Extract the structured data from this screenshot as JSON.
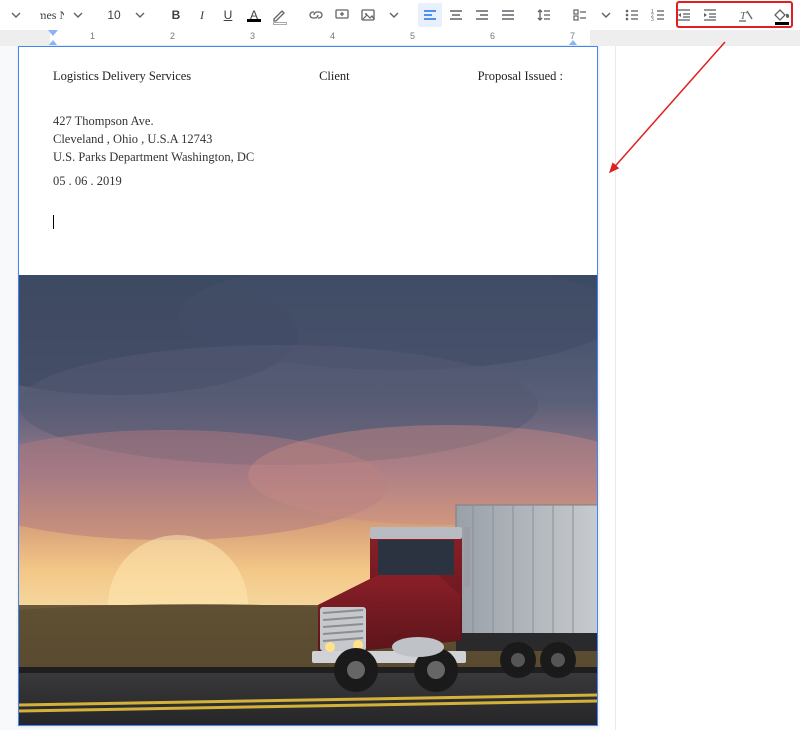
{
  "toolbar": {
    "font_name": "Times N...",
    "font_size": "10"
  },
  "ruler": {
    "numbers": [
      "1",
      "2",
      "3",
      "4",
      "5",
      "6",
      "7"
    ]
  },
  "doc": {
    "header": {
      "col1": "Logistics Delivery Services",
      "col2": "Client",
      "col3": "Proposal Issued :"
    },
    "address": {
      "line1": "427 Thompson Ave.",
      "line2": "Cleveland , Ohio , U.S.A 12743",
      "line3": "U.S. Parks Department Washington, DC",
      "date": "05 . 06 . 2019"
    }
  },
  "icons": {
    "caret": "chevron-down-icon",
    "bold": "B",
    "italic": "I",
    "underline": "U"
  }
}
